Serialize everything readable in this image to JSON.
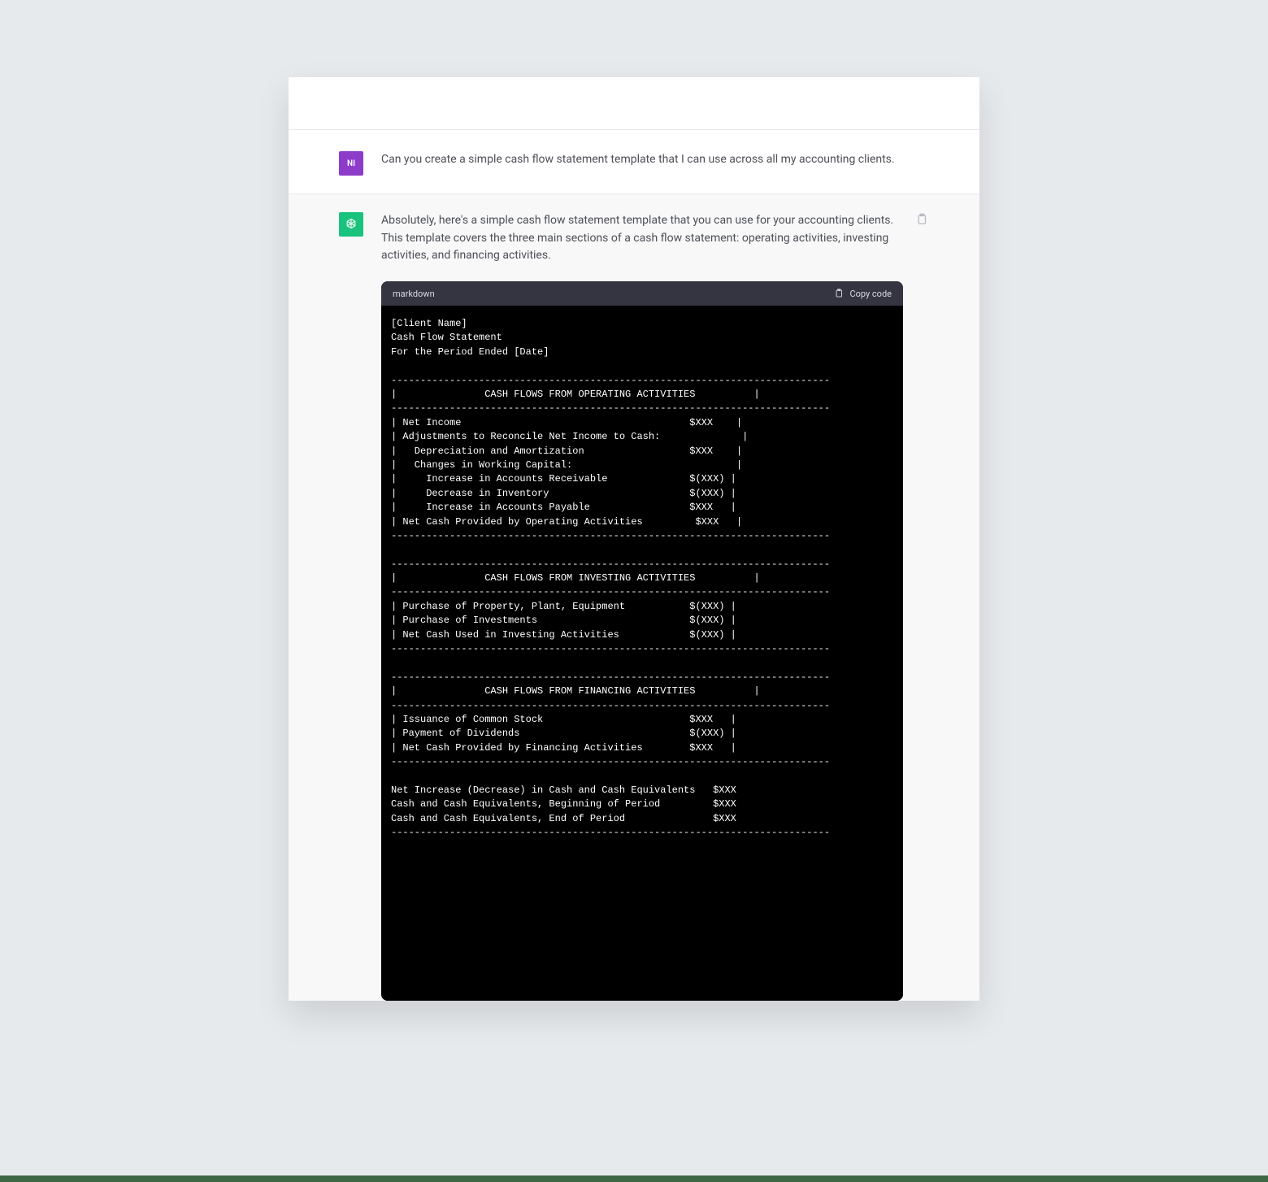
{
  "user": {
    "avatar_initials": "NI",
    "message": "Can you create a simple cash flow statement template that I can use across all my accounting clients."
  },
  "assistant": {
    "intro": "Absolutely, here's a simple cash flow statement template that you can use for your accounting clients. This template covers the three main sections of a cash flow statement: operating activities, investing activities, and financing activities.",
    "code_lang": "markdown",
    "copy_label": "Copy code",
    "code_lines": [
      "[Client Name]",
      "Cash Flow Statement",
      "For the Period Ended [Date]",
      "",
      "---------------------------------------------------------------------------",
      "|               CASH FLOWS FROM OPERATING ACTIVITIES          |",
      "---------------------------------------------------------------------------",
      "| Net Income                                       $XXX    |",
      "| Adjustments to Reconcile Net Income to Cash:              |",
      "|   Depreciation and Amortization                  $XXX    |",
      "|   Changes in Working Capital:                            |",
      "|     Increase in Accounts Receivable              $(XXX) |",
      "|     Decrease in Inventory                        $(XXX) |",
      "|     Increase in Accounts Payable                 $XXX   |",
      "| Net Cash Provided by Operating Activities         $XXX   |",
      "---------------------------------------------------------------------------",
      "",
      "---------------------------------------------------------------------------",
      "|               CASH FLOWS FROM INVESTING ACTIVITIES          |",
      "---------------------------------------------------------------------------",
      "| Purchase of Property, Plant, Equipment           $(XXX) |",
      "| Purchase of Investments                          $(XXX) |",
      "| Net Cash Used in Investing Activities            $(XXX) |",
      "---------------------------------------------------------------------------",
      "",
      "---------------------------------------------------------------------------",
      "|               CASH FLOWS FROM FINANCING ACTIVITIES          |",
      "---------------------------------------------------------------------------",
      "| Issuance of Common Stock                         $XXX   |",
      "| Payment of Dividends                             $(XXX) |",
      "| Net Cash Provided by Financing Activities        $XXX   |",
      "---------------------------------------------------------------------------",
      "",
      "Net Increase (Decrease) in Cash and Cash Equivalents   $XXX",
      "Cash and Cash Equivalents, Beginning of Period         $XXX",
      "Cash and Cash Equivalents, End of Period               $XXX",
      "---------------------------------------------------------------------------"
    ]
  }
}
